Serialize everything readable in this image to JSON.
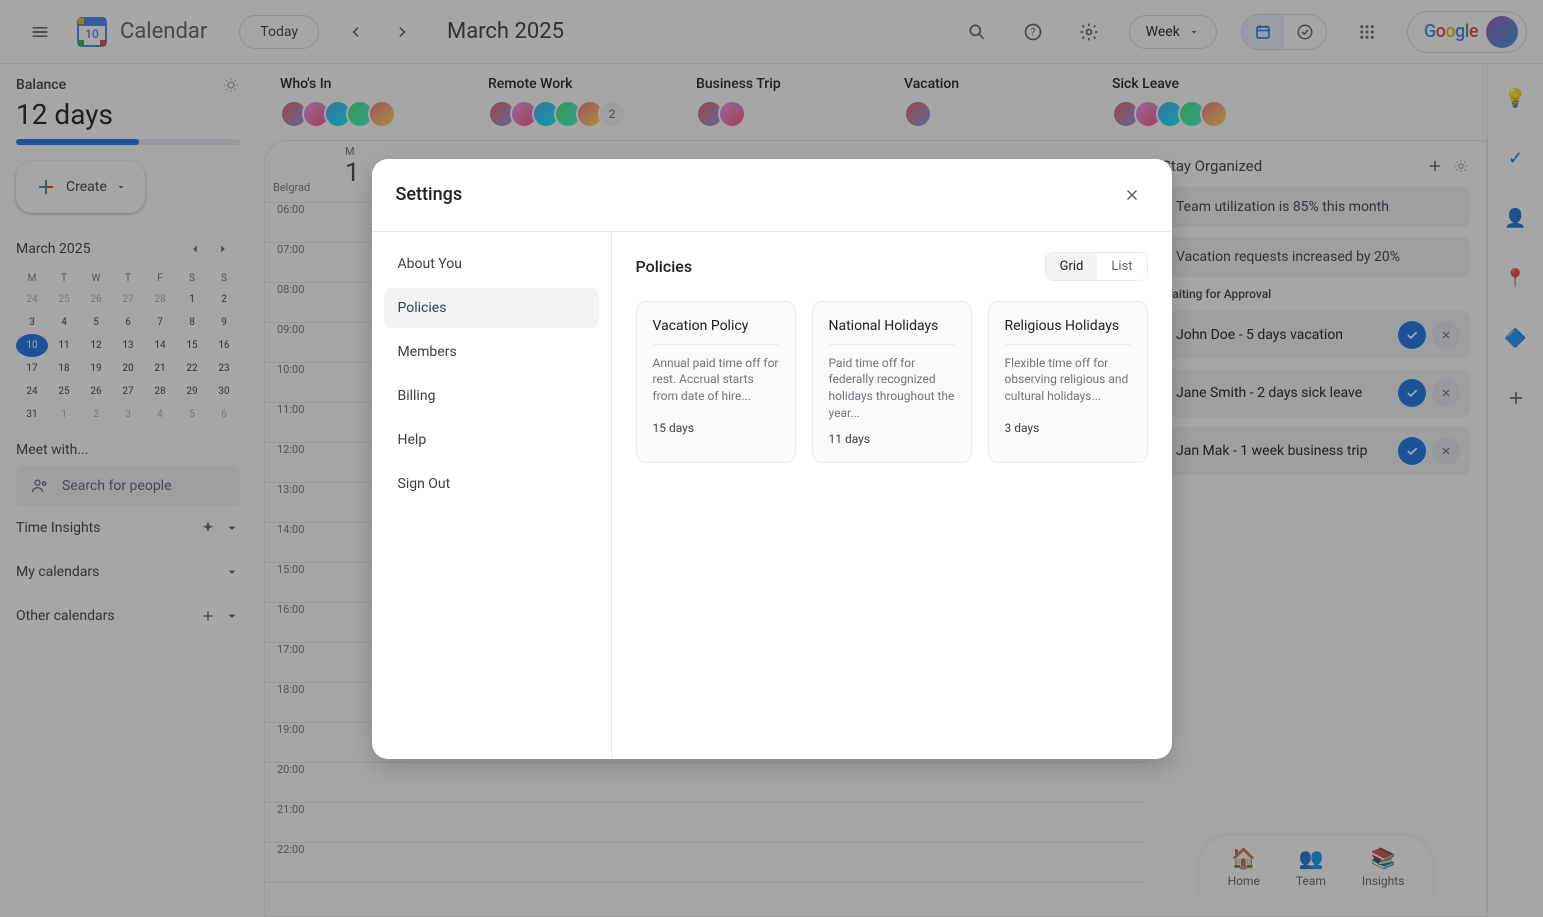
{
  "header": {
    "app_name": "Calendar",
    "today": "Today",
    "title": "March 2025",
    "view": "Week"
  },
  "sidebar": {
    "balance_label": "Balance",
    "balance_value": "12 days",
    "create": "Create",
    "mini_cal_title": "March 2025",
    "dows": [
      "M",
      "T",
      "W",
      "T",
      "F",
      "S",
      "S"
    ],
    "weeks": [
      [
        {
          "d": "24",
          "dim": true
        },
        {
          "d": "25",
          "dim": true
        },
        {
          "d": "26",
          "dim": true
        },
        {
          "d": "27",
          "dim": true
        },
        {
          "d": "28",
          "dim": true
        },
        {
          "d": "1"
        },
        {
          "d": "2"
        }
      ],
      [
        {
          "d": "3"
        },
        {
          "d": "4"
        },
        {
          "d": "5"
        },
        {
          "d": "6"
        },
        {
          "d": "7"
        },
        {
          "d": "8"
        },
        {
          "d": "9"
        }
      ],
      [
        {
          "d": "10",
          "today": true
        },
        {
          "d": "11"
        },
        {
          "d": "12"
        },
        {
          "d": "13"
        },
        {
          "d": "14"
        },
        {
          "d": "15"
        },
        {
          "d": "16"
        }
      ],
      [
        {
          "d": "17"
        },
        {
          "d": "18"
        },
        {
          "d": "19"
        },
        {
          "d": "20"
        },
        {
          "d": "21"
        },
        {
          "d": "22"
        },
        {
          "d": "23"
        }
      ],
      [
        {
          "d": "24"
        },
        {
          "d": "25"
        },
        {
          "d": "26"
        },
        {
          "d": "27"
        },
        {
          "d": "28"
        },
        {
          "d": "29"
        },
        {
          "d": "30"
        }
      ],
      [
        {
          "d": "31"
        },
        {
          "d": "1",
          "dim": true
        },
        {
          "d": "2",
          "dim": true
        },
        {
          "d": "3",
          "dim": true
        },
        {
          "d": "4",
          "dim": true
        },
        {
          "d": "5",
          "dim": true
        },
        {
          "d": "6",
          "dim": true
        }
      ]
    ],
    "meet_with": "Meet with...",
    "search_people": "Search for people",
    "time_insights": "Time Insights",
    "my_calendars": "My calendars",
    "other_calendars": "Other calendars"
  },
  "status": {
    "cols": [
      {
        "label": "Who's In",
        "avatars": 5
      },
      {
        "label": "Remote Work",
        "avatars": 5,
        "more": "2"
      },
      {
        "label": "Business Trip",
        "avatars": 2
      },
      {
        "label": "Vacation",
        "avatars": 1
      },
      {
        "label": "Sick Leave",
        "avatars": 5
      }
    ]
  },
  "calendar": {
    "tz": "Belgrad",
    "day_short": "M",
    "day_num": "1",
    "times": [
      "06:00",
      "07:00",
      "08:00",
      "09:00",
      "10:00",
      "11:00",
      "12:00",
      "13:00",
      "14:00",
      "15:00",
      "16:00",
      "17:00",
      "18:00",
      "19:00",
      "20:00",
      "21:00",
      "22:00"
    ]
  },
  "right": {
    "title": "Stay Organized",
    "info1": "Team utilization is 85% this month",
    "info2": "Vacation requests increased by 20%",
    "section": "Waiting for Approval",
    "approvals": [
      {
        "text": "John Doe - 5 days vacation"
      },
      {
        "text": "Jane Smith - 2 days sick leave"
      },
      {
        "text": "Jan Mak - 1 week business trip"
      }
    ],
    "tabs": [
      "Home",
      "Team",
      "Insights"
    ],
    "tab_icons": [
      "🏠",
      "👥",
      "📚"
    ]
  },
  "modal": {
    "title": "Settings",
    "nav": [
      "About You",
      "Policies",
      "Members",
      "Billing",
      "Help",
      "Sign Out"
    ],
    "active_nav": 1,
    "content_title": "Policies",
    "grid": "Grid",
    "list": "List",
    "policies": [
      {
        "title": "Vacation Policy",
        "desc": "Annual paid time off for rest. Accrual starts from date of hire...",
        "days": "15 days"
      },
      {
        "title": "National Holidays",
        "desc": "Paid time off for federally recognized holidays throughout the year...",
        "days": "11 days"
      },
      {
        "title": "Religious Holidays",
        "desc": "Flexible time off for observing religious and cultural holidays...",
        "days": "3 days"
      }
    ]
  }
}
